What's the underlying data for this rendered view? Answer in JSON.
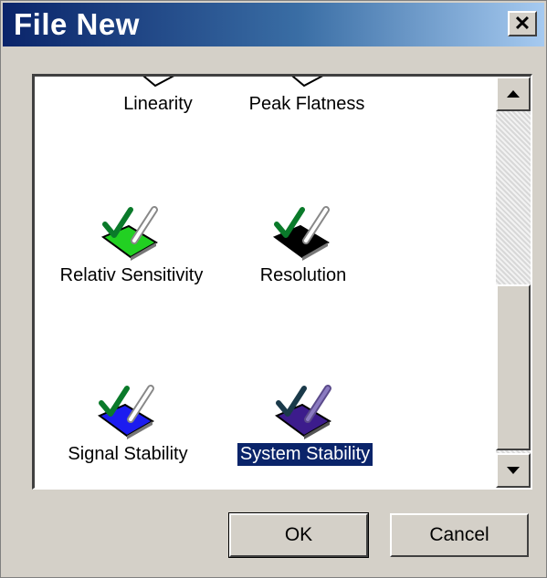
{
  "window": {
    "title": "File New"
  },
  "items": [
    {
      "label": "Linearity",
      "icon": "template-icon",
      "color": "#ffffff"
    },
    {
      "label": "Peak Flatness",
      "icon": "template-icon",
      "color": "#ffffff"
    },
    {
      "label": "Relativ Sensitivity",
      "icon": "template-green-icon",
      "color": "#22d022"
    },
    {
      "label": "Resolution",
      "icon": "template-black-icon",
      "color": "#000000"
    },
    {
      "label": "Signal Stability",
      "icon": "template-blue-icon",
      "color": "#1c1cf0"
    },
    {
      "label": "System Stability",
      "icon": "template-purple-icon",
      "color": "#3c1c8c",
      "selected": true
    }
  ],
  "buttons": {
    "ok": "OK",
    "cancel": "Cancel"
  },
  "colors": {
    "selection": "#0a246a",
    "face": "#d4d0c8",
    "check": "#0a7a2a"
  }
}
